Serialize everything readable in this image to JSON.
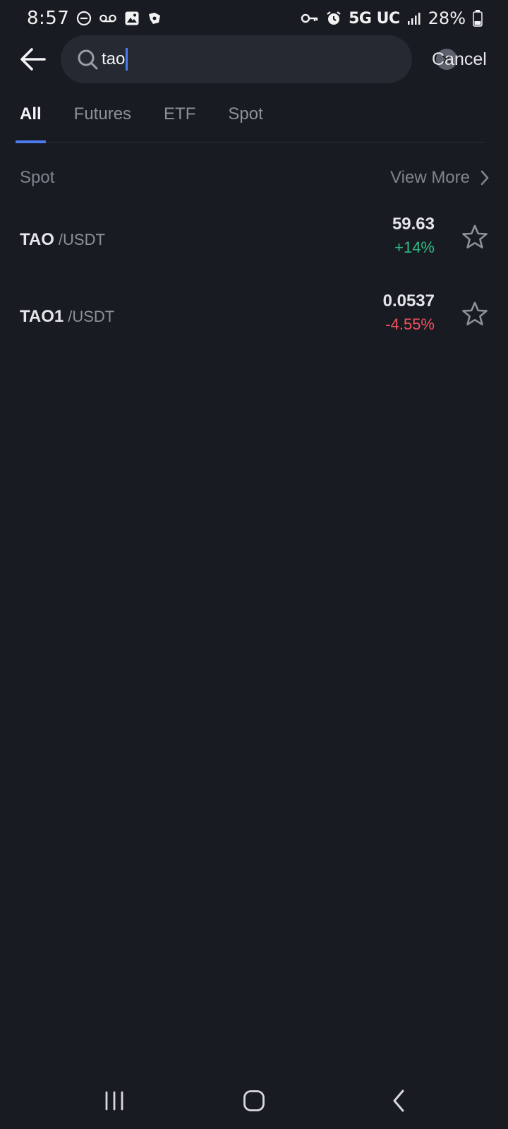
{
  "status_bar": {
    "time": "8:57",
    "network": "5G UC",
    "battery": "28%"
  },
  "search": {
    "query": "tao",
    "cancel_label": "Cancel"
  },
  "tabs": [
    {
      "label": "All",
      "active": true
    },
    {
      "label": "Futures",
      "active": false
    },
    {
      "label": "ETF",
      "active": false
    },
    {
      "label": "Spot",
      "active": false
    }
  ],
  "section": {
    "title": "Spot",
    "view_more_label": "View More"
  },
  "results": [
    {
      "base": "TAO",
      "quote": "/USDT",
      "price": "59.63",
      "change": "+14%",
      "direction": "up"
    },
    {
      "base": "TAO1",
      "quote": "/USDT",
      "price": "0.0537",
      "change": "-4.55%",
      "direction": "down"
    }
  ],
  "colors": {
    "background": "#181b21",
    "accent": "#4a7cf0",
    "up": "#2fbd85",
    "down": "#f0545f"
  }
}
